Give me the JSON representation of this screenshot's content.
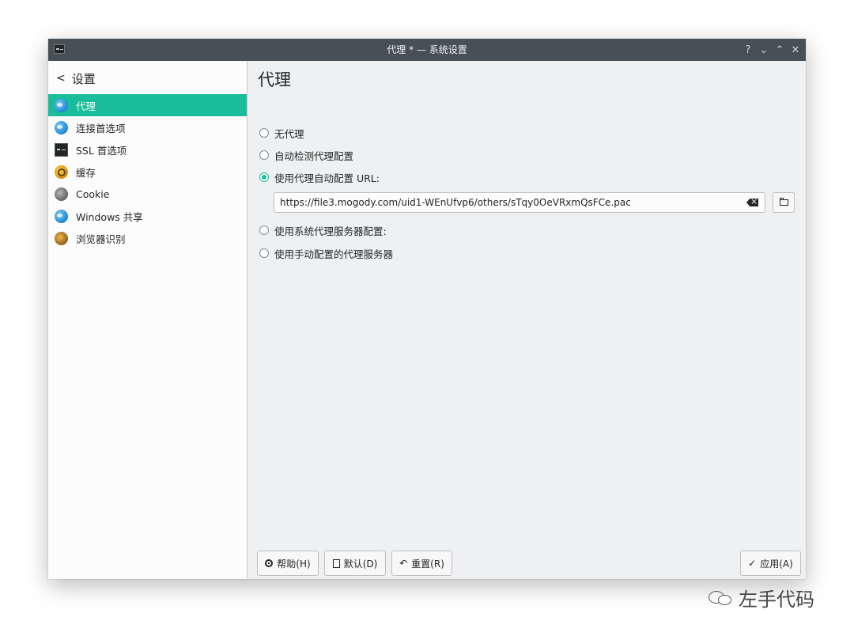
{
  "window": {
    "title": "代理 * — 系统设置",
    "controls": [
      "?",
      "⌄",
      "⌃",
      "✕"
    ]
  },
  "sidebar": {
    "back_label": "设置",
    "items": [
      {
        "label": "代理",
        "icon": "globe-icon",
        "active": true
      },
      {
        "label": "连接首选项",
        "icon": "globe-icon",
        "active": false
      },
      {
        "label": "SSL 首选项",
        "icon": "terminal-icon",
        "active": false
      },
      {
        "label": "缓存",
        "icon": "cache-icon",
        "active": false
      },
      {
        "label": "Cookie",
        "icon": "cookie-icon",
        "active": false
      },
      {
        "label": "Windows 共享",
        "icon": "globe-icon",
        "active": false
      },
      {
        "label": "浏览器识别",
        "icon": "browser-icon",
        "active": false
      }
    ]
  },
  "main": {
    "title": "代理",
    "options": [
      {
        "label": "无代理",
        "checked": false
      },
      {
        "label": "自动检测代理配置",
        "checked": false
      },
      {
        "label": "使用代理自动配置 URL:",
        "checked": true
      },
      {
        "label": "使用系统代理服务器配置:",
        "checked": false
      },
      {
        "label": "使用手动配置的代理服务器",
        "checked": false
      }
    ],
    "pac_url": "https://file3.mogody.com/uid1-WEnUfvp6/others/sTqy0OeVRxmQsFCe.pac"
  },
  "buttons": {
    "help": "帮助(H)",
    "defaults": "默认(D)",
    "reset": "重置(R)",
    "apply": "应用(A)",
    "reset_icon": "↶",
    "apply_icon": "✓"
  },
  "watermark": {
    "text": "左手代码"
  },
  "colors": {
    "accent": "#1abc9c",
    "titlebar": "#475057",
    "window_bg": "#eff0f1"
  }
}
